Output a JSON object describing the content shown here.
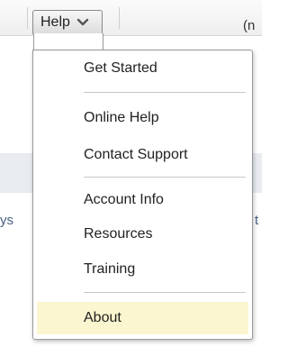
{
  "toolbar": {
    "help_label": "Help",
    "right_text": "(n"
  },
  "background": {
    "left_fragment": "ys",
    "right_fragment": "t"
  },
  "help_menu": {
    "items": [
      {
        "label": "Get Started"
      },
      {
        "label": "Online Help"
      },
      {
        "label": "Contact Support"
      },
      {
        "label": "Account Info"
      },
      {
        "label": "Resources"
      },
      {
        "label": "Training"
      },
      {
        "label": "About",
        "highlighted": true
      }
    ]
  },
  "colors": {
    "highlight": "#fbf6cf",
    "menu_border": "#9a9a9a"
  },
  "icons": {
    "help_dropdown": "chevron-down-icon"
  }
}
